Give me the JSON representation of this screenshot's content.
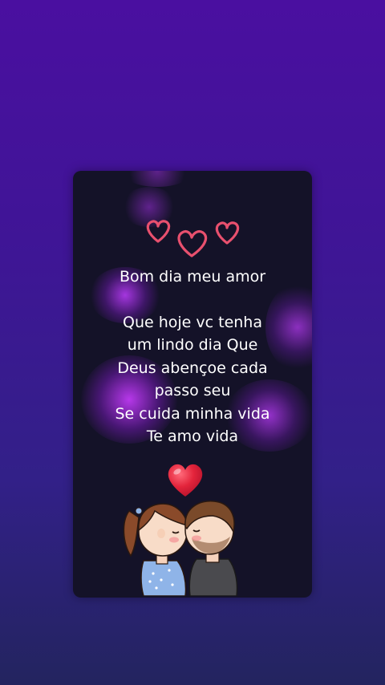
{
  "card": {
    "greeting": "Bom dia meu amor",
    "lines": [
      "Que hoje vc tenha",
      "um lindo dia Que",
      "Deus abençoe cada",
      "passo seu",
      "Se cuida minha vida",
      "Te amo vida"
    ],
    "decorations": {
      "top_icon": "three-outline-hearts-icon",
      "bottom_icon": "red-heart-icon",
      "illustration": "kissing-couple-illustration"
    }
  },
  "colors": {
    "background_top": "#4a0fa0",
    "background_bottom": "#23245f",
    "card_background": "#141228",
    "glow": "#be3cff",
    "outline_hearts": "#e8506e",
    "red_heart": "#e3243b",
    "text": "#ffffff"
  }
}
